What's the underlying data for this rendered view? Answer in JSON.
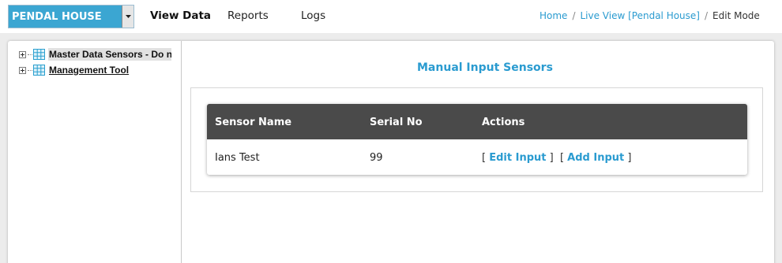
{
  "site_selector": {
    "value": "PENDAL HOUSE"
  },
  "nav": {
    "view_data": "View Data",
    "reports": "Reports",
    "logs": "Logs"
  },
  "breadcrumb": {
    "home": "Home",
    "live_view": "Live View [Pendal House]",
    "current": "Edit Mode",
    "separator": "/"
  },
  "tree": {
    "items": [
      {
        "label": "Master Data Sensors - Do no",
        "selected": true
      },
      {
        "label": "Management Tool",
        "selected": false
      }
    ]
  },
  "main": {
    "title": "Manual Input Sensors",
    "table": {
      "headers": [
        "Sensor Name",
        "Serial No",
        "Actions"
      ],
      "rows": [
        {
          "sensor_name": "Ians Test",
          "serial_no": "99",
          "edit_label": "Edit Input",
          "add_label": "Add Input"
        }
      ]
    }
  },
  "colors": {
    "accent": "#2a9bd0",
    "selector_bg": "#3ba6d2",
    "table_header_bg": "#4a4a4a"
  }
}
